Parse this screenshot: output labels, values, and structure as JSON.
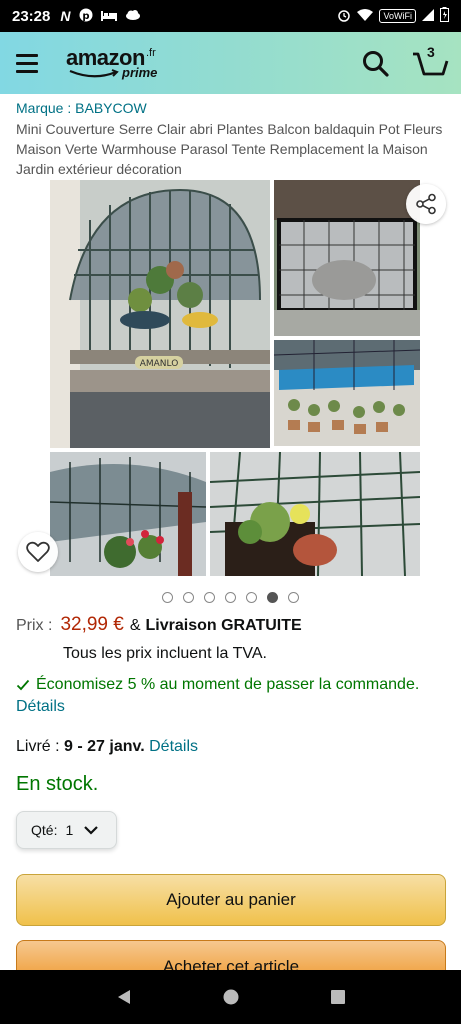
{
  "status_bar": {
    "time": "23:28",
    "wifi_badge": "VoWiFi"
  },
  "header": {
    "logo_text": "amazon",
    "logo_tld": ".fr",
    "logo_sub": "prime",
    "cart_count": "3",
    "icons": [
      "menu-icon",
      "search-icon",
      "cart-icon"
    ]
  },
  "product": {
    "brand": "Marque : BABYCOW",
    "title": "Mini Couverture Serre Clair abri Plantes Balcon baldaquin Pot Fleurs Maison Verte Warmhouse Parasol Tente Remplacement la Maison Jardin extérieur décoration",
    "image_text": "AMANLO",
    "gallery": {
      "dot_count": 7,
      "active_index": 5
    }
  },
  "price": {
    "label": "Prix :",
    "value": "32,99 €",
    "amp": "&",
    "delivery": "Livraison GRATUITE",
    "tva_note": "Tous les prix incluent la TVA."
  },
  "savings": {
    "text": "Économisez 5 % au moment de passer la commande.",
    "details_link": "Détails"
  },
  "delivery": {
    "label": "Livré :",
    "dates": "9 - 27 janv.",
    "link": "Détails"
  },
  "stock": "En stock.",
  "quantity": {
    "label": "Qté:",
    "value": "1"
  },
  "actions": {
    "add_to_cart": "Ajouter au panier",
    "buy_now": "Acheter cet article"
  },
  "colors": {
    "link": "#007185",
    "price": "#b12704",
    "in_stock": "#007600",
    "cart_button": "#f0c14b",
    "buy_button": "#ed9220"
  }
}
